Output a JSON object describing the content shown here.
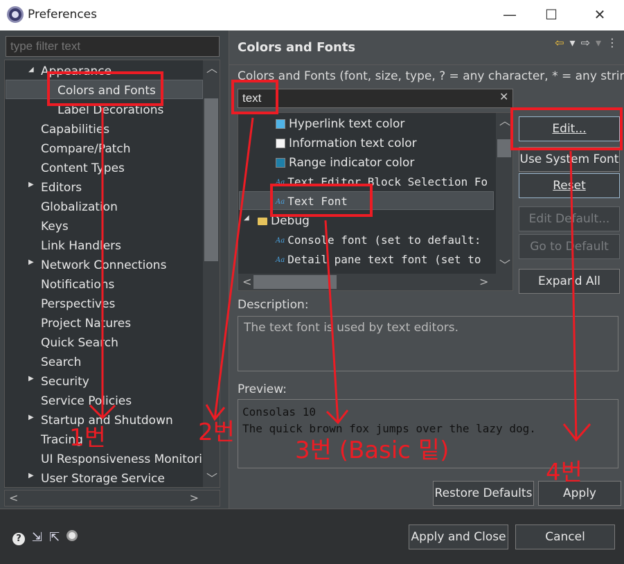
{
  "window": {
    "title": "Preferences",
    "minimize": "—",
    "maximize": "☐",
    "close": "✕"
  },
  "left": {
    "filter_placeholder": "type filter text",
    "tree": [
      {
        "label": "Appearance",
        "indent": 1,
        "expanded": true
      },
      {
        "label": "Colors and Fonts",
        "indent": 2,
        "selected": true
      },
      {
        "label": "Label Decorations",
        "indent": 2
      },
      {
        "label": "Capabilities",
        "indent": 1
      },
      {
        "label": "Compare/Patch",
        "indent": 1
      },
      {
        "label": "Content Types",
        "indent": 1
      },
      {
        "label": "Editors",
        "indent": 1,
        "collapsed": true
      },
      {
        "label": "Globalization",
        "indent": 1
      },
      {
        "label": "Keys",
        "indent": 1
      },
      {
        "label": "Link Handlers",
        "indent": 1
      },
      {
        "label": "Network Connections",
        "indent": 1,
        "collapsed": true
      },
      {
        "label": "Notifications",
        "indent": 1
      },
      {
        "label": "Perspectives",
        "indent": 1
      },
      {
        "label": "Project Natures",
        "indent": 1
      },
      {
        "label": "Quick Search",
        "indent": 1
      },
      {
        "label": "Search",
        "indent": 1
      },
      {
        "label": "Security",
        "indent": 1,
        "collapsed": true
      },
      {
        "label": "Service Policies",
        "indent": 1
      },
      {
        "label": "Startup and Shutdown",
        "indent": 1,
        "collapsed": true
      },
      {
        "label": "Tracing",
        "indent": 1
      },
      {
        "label": "UI Responsiveness Monitoring",
        "indent": 1
      },
      {
        "label": "User Storage Service",
        "indent": 1,
        "collapsed": true
      }
    ]
  },
  "right": {
    "title": "Colors and Fonts",
    "nav": {
      "back": "⇦",
      "back_menu": "▾",
      "forward": "⇨",
      "forward_menu": "▾",
      "more": "⋮"
    },
    "filter_label": "Colors and Fonts (font, size, type, ? = any character, * = any string) :",
    "filter_value": "text",
    "filter_clear": "✕",
    "tree": [
      {
        "label": "Hyperlink text color",
        "kind": "color",
        "color": "#4fb3e6"
      },
      {
        "label": "Information text color",
        "kind": "color",
        "color": "#f5f5f5"
      },
      {
        "label": "Range indicator color",
        "kind": "color",
        "color": "#1e7fa8"
      },
      {
        "label": "Text Editor Block Selection Fo",
        "kind": "font"
      },
      {
        "label": "Text Font",
        "kind": "font",
        "selected": true
      },
      {
        "label": "Debug",
        "kind": "folder"
      },
      {
        "label": "Console font (set to default:",
        "kind": "font"
      },
      {
        "label": "Detail pane text font (set to",
        "kind": "font"
      }
    ],
    "buttons": {
      "edit": "Edit...",
      "use_system_font": "Use System Font",
      "reset": "Reset",
      "edit_default": "Edit Default...",
      "go_to_default": "Go to Default",
      "expand_all": "Expand All"
    },
    "description_label": "Description:",
    "description_text": "The text font is used by text editors.",
    "preview_label": "Preview:",
    "preview_lines": [
      "Consolas 10",
      "The quick brown fox jumps over the lazy dog."
    ],
    "restore_defaults": "Restore Defaults",
    "apply": "Apply"
  },
  "footer": {
    "apply_and_close": "Apply and Close",
    "cancel": "Cancel",
    "icons": [
      "help-icon",
      "import-icon",
      "export-icon",
      "oomph-icon"
    ]
  },
  "annotations": {
    "step1": "1번",
    "step2": "2번",
    "step3": "3번 (Basic 밑)",
    "step4": "4번"
  },
  "colors": {
    "annotation": "#ed1c24",
    "back_arrow": "#f3c23c"
  }
}
